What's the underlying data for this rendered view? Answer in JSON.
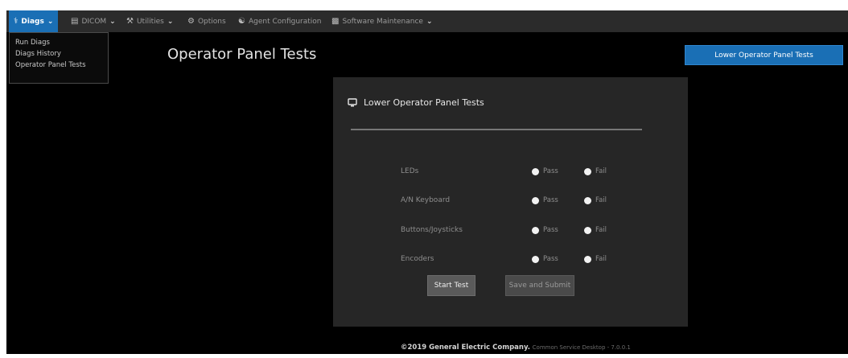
{
  "navbar": {
    "items": [
      {
        "label": "Diags",
        "icon": "stethoscope-icon",
        "has_caret": true
      },
      {
        "label": "DICOM",
        "icon": "database-icon",
        "has_caret": true
      },
      {
        "label": "Utilities",
        "icon": "tools-icon",
        "has_caret": true
      },
      {
        "label": "Options",
        "icon": "gear-icon",
        "has_caret": false
      },
      {
        "label": "Agent Configuration",
        "icon": "users-icon",
        "has_caret": false
      },
      {
        "label": "Software Maintenance",
        "icon": "stack-icon",
        "has_caret": true
      }
    ]
  },
  "dropdown": {
    "items": [
      "Run Diags",
      "Diags History",
      "Operator Panel Tests"
    ]
  },
  "page": {
    "title": "Operator Panel Tests",
    "top_right_button": "Lower Operator Panel Tests"
  },
  "card": {
    "title": "Lower Operator Panel Tests",
    "tests": [
      {
        "label": "LEDs",
        "pass": "Pass",
        "fail": "Fail"
      },
      {
        "label": "A/N Keyboard",
        "pass": "Pass",
        "fail": "Fail"
      },
      {
        "label": "Buttons/Joysticks",
        "pass": "Pass",
        "fail": "Fail"
      },
      {
        "label": "Encoders",
        "pass": "Pass",
        "fail": "Fail"
      }
    ],
    "start_button": "Start Test",
    "save_button": "Save and Submit"
  },
  "footer": {
    "copyright": "©2019 General Electric Company.",
    "version": "Common Service Desktop - 7.0.0.1"
  },
  "colors": {
    "accent": "#1a6fb5",
    "navbar_bg": "#2b2b2b",
    "card_bg": "#262626",
    "page_bg": "#000000"
  }
}
